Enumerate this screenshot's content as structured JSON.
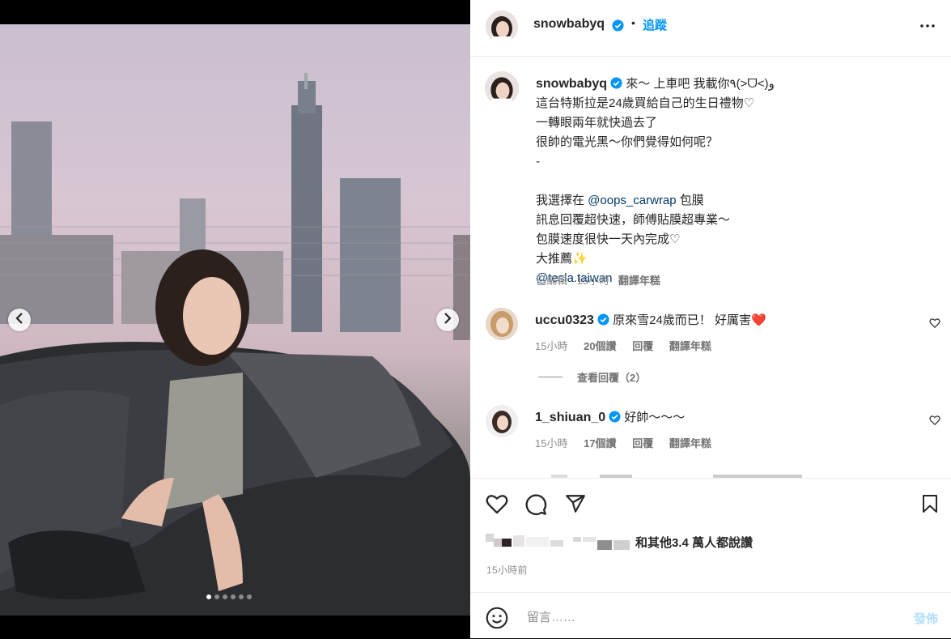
{
  "post": {
    "author": "snowbabyq",
    "follow_label": "追蹤",
    "separator": "•"
  },
  "caption": {
    "username": "snowbabyq",
    "lines": [
      "來～ 上車吧 我載你٩(>ᗜ<)و",
      "這台特斯拉是24歲買給自己的生日禮物♡",
      "一轉眼兩年就快過去了",
      "很帥的電光黑～你們覺得如何呢？",
      "-",
      "",
      "我選擇在 ",
      "訊息回覆超快速，師傅貼膜超專業～",
      "包膜速度很快一天內完成♡",
      "大推薦✨",
      ""
    ],
    "mention_wrap": "@oops_carwrap",
    "mention_wrap_suffix": " 包膜",
    "mention_tesla": "@tesla.taiwan",
    "meta_edited": "已編輯 · 15小時",
    "meta_translate": "翻譯年糕"
  },
  "comments": [
    {
      "username": "uccu0323",
      "text": "原來雪24歲而已！ 好厲害",
      "emoji": "❤️",
      "time": "15小時",
      "likes": "20個讚",
      "reply": "回覆",
      "translate": "翻譯年糕"
    },
    {
      "username": "1_shiuan_0",
      "text": "好帥～～～",
      "time": "15小時",
      "likes": "17個讚",
      "reply": "回覆",
      "translate": "翻譯年糕"
    }
  ],
  "view_replies": "查看回覆（2）",
  "likes_summary": "和其他3.4 萬人都說讚",
  "timestamp": "15小時前",
  "comment_input": {
    "placeholder": "留言……",
    "post_label": "發佈"
  },
  "carousel": {
    "count": 6,
    "active_index": 0
  },
  "colors": {
    "accent": "#0095f6",
    "verified": "#0095f6",
    "mention": "#00376b",
    "post_disabled": "#b2dffc"
  }
}
